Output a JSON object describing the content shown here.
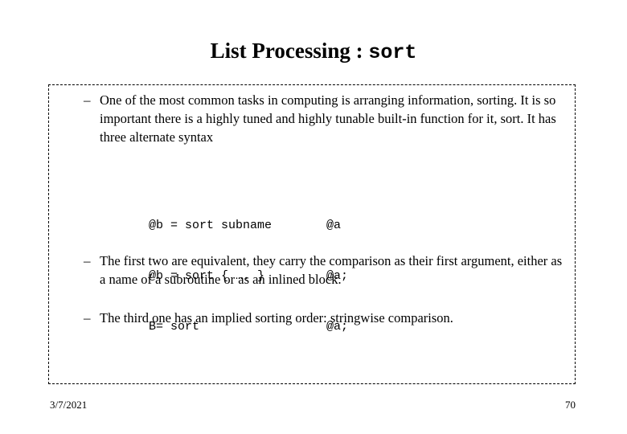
{
  "slide": {
    "title_serif": "List Processing : ",
    "title_mono": "sort",
    "page_number": "70",
    "date": "3/7/2021"
  },
  "bullets": [
    {
      "marker": "–",
      "text": "One of the most common tasks in computing is arranging information, sorting. It is so important there is a highly tuned and highly tunable built-in function for it, sort. It has three alternate syntax"
    },
    {
      "marker": "–",
      "text": "The first two are equivalent, they carry the comparison as their first argument, either as a name of a subroutine or as an inlined block."
    },
    {
      "marker": "–",
      "text": "The third one has an implied sorting order: stringwise comparison."
    }
  ],
  "code_block": {
    "lines": [
      {
        "left": "@b = sort subname",
        "right": "@a"
      },
      {
        "left": "@b = sort { …. }",
        "right": "@a;"
      },
      {
        "left": "B= sort",
        "right": "@a;"
      }
    ]
  }
}
